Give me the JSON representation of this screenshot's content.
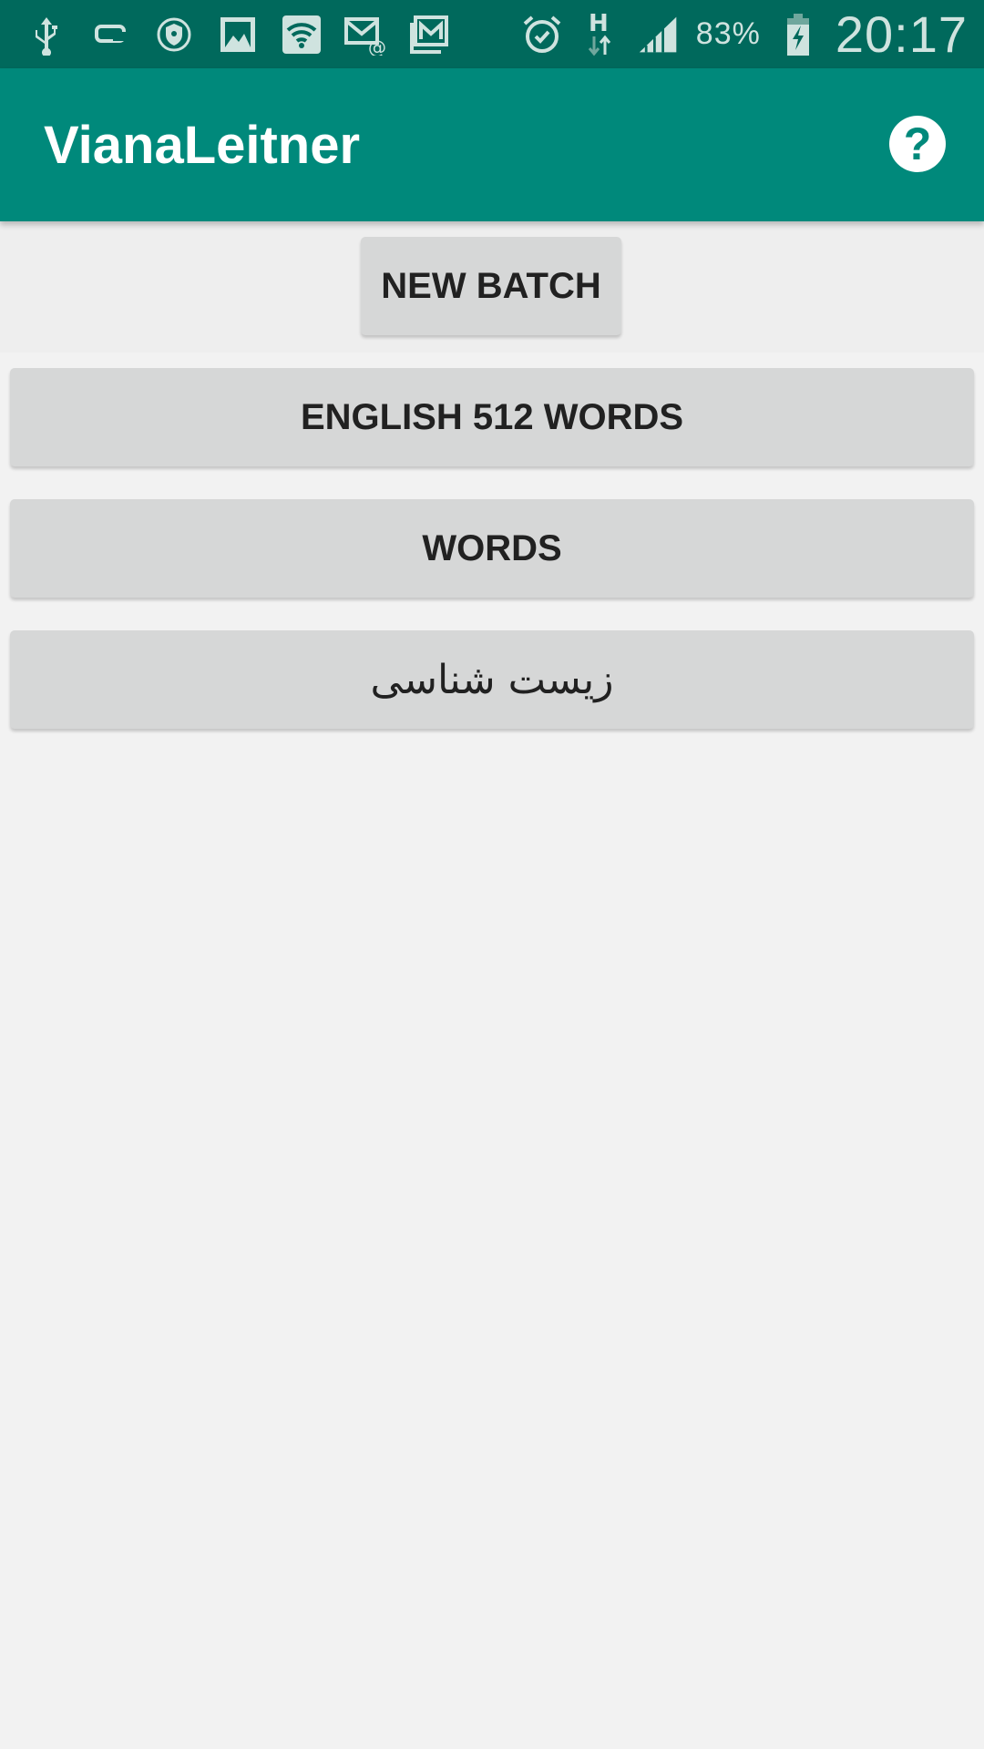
{
  "status_bar": {
    "left_icons": [
      "usb-icon",
      "phone-link-icon",
      "vpn-shield-icon",
      "gallery-icon",
      "wifi-icon",
      "email-icon",
      "gmail-icon"
    ],
    "right_icons": [
      "alarm-icon",
      "network-h-icon",
      "signal-icon",
      "battery-charging-icon"
    ],
    "battery": "83%",
    "time": "20:17"
  },
  "app_bar": {
    "title": "VianaLeitner",
    "help_label": "?"
  },
  "actions": {
    "new_batch_label": "NEW BATCH"
  },
  "batches": [
    {
      "label": "ENGLISH 512 WORDS"
    },
    {
      "label": "WORDS"
    },
    {
      "label": "زیست شناسی"
    }
  ],
  "colors": {
    "status_bar": "#00695c",
    "app_bar": "#00897b",
    "button": "#d6d7d7",
    "background": "#f2f2f2"
  }
}
